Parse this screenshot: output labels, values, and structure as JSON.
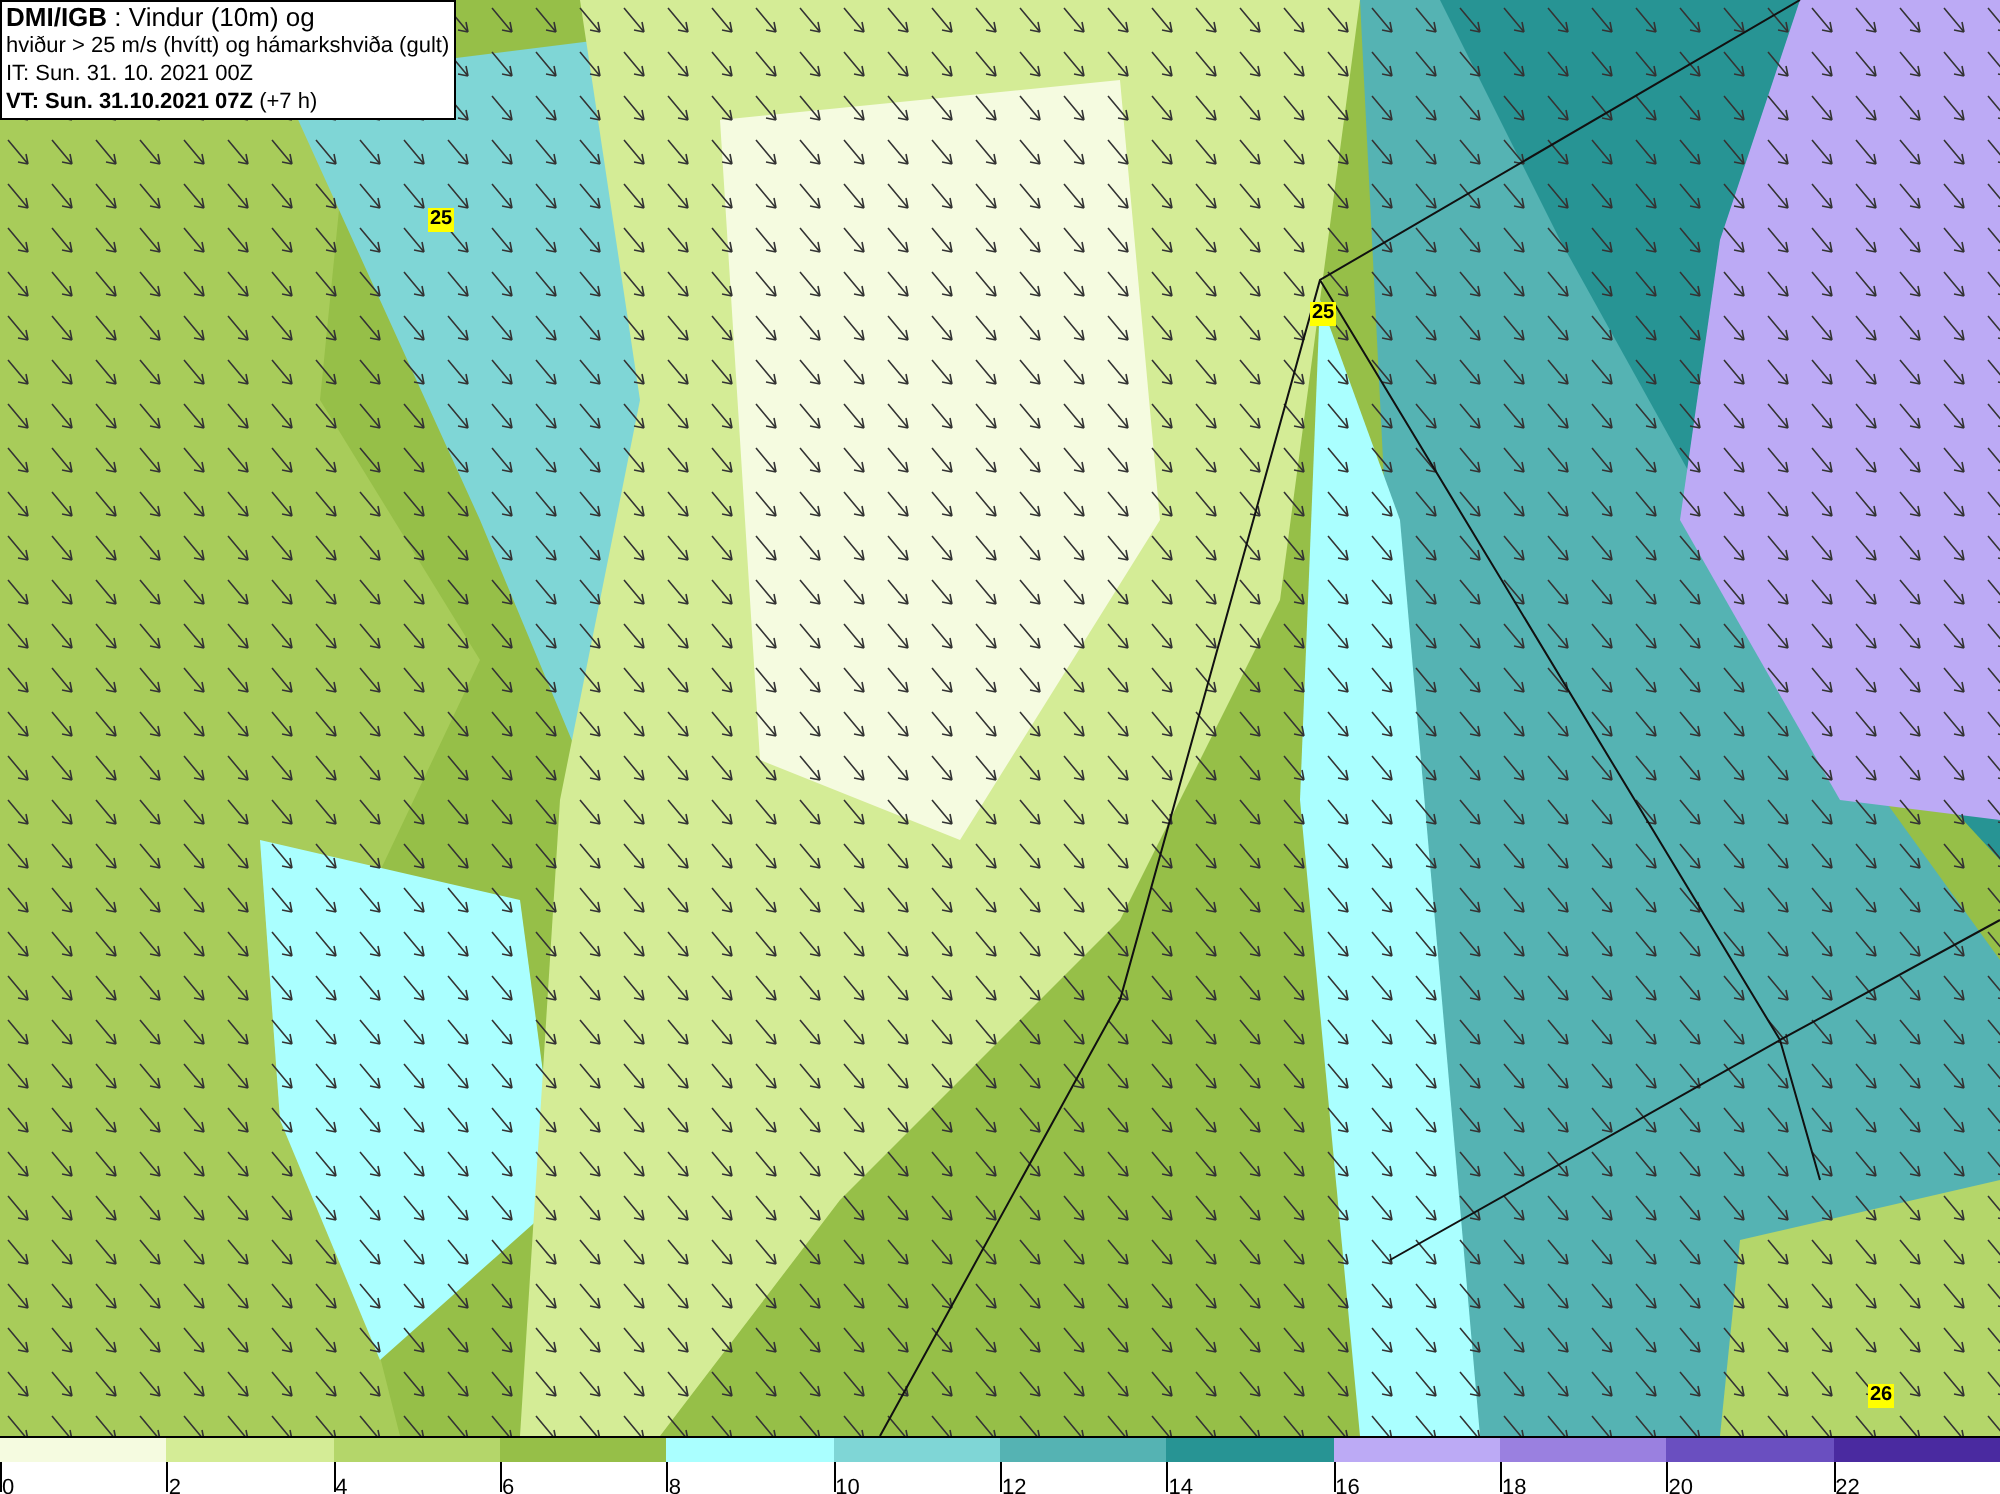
{
  "title_box": {
    "lines": [
      "**DMI/IGB** : Vindur (10m) og",
      "hviður > 25 m/s (hvítt) og hámarkshviða (gult)",
      "IT: Sun. 31. 10. 2021 00Z",
      "**VT: Sun. 31.10.2021 07Z** (+7 h)"
    ]
  },
  "gust_labels": [
    "25",
    "25",
    "26"
  ],
  "colorbar": [
    {
      "label": "0",
      "color": "#f5fbe0"
    },
    {
      "label": "2",
      "color": "#d4ec96"
    },
    {
      "label": "4",
      "color": "#b4d66a"
    },
    {
      "label": "6",
      "color": "#96bf48"
    },
    {
      "label": "8",
      "color": "#aaffff"
    },
    {
      "label": "10",
      "color": "#7fd6d6"
    },
    {
      "label": "12",
      "color": "#55b3b3"
    },
    {
      "label": "14",
      "color": "#279494"
    },
    {
      "label": "16",
      "color": "#bcaaf5"
    },
    {
      "label": "18",
      "color": "#9a80e0"
    },
    {
      "label": "20",
      "color": "#6a4fc0"
    },
    {
      "label": "22",
      "color": "#4a2aa0"
    }
  ]
}
